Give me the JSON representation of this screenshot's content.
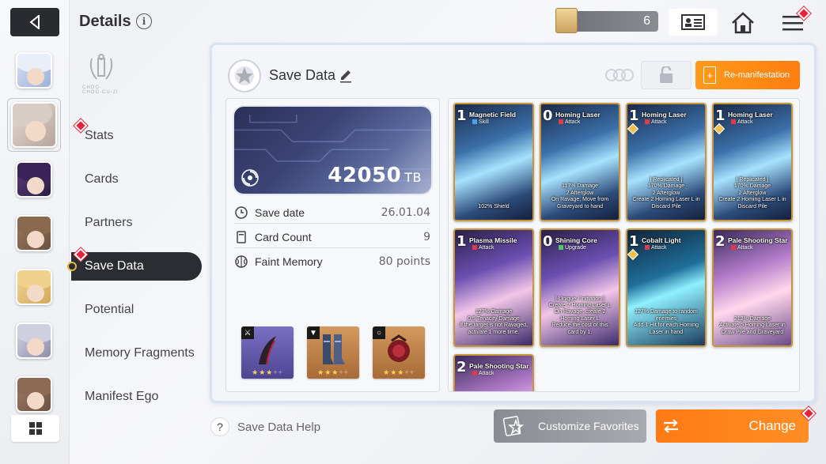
{
  "header": {
    "title": "Details",
    "info_icon": "i",
    "currency_value": "6",
    "icons": [
      "back-arrow-icon",
      "currency-ticket-icon",
      "profile-card-icon",
      "home-icon",
      "menu-icon"
    ]
  },
  "nav": {
    "items": [
      {
        "label": "Stats"
      },
      {
        "label": "Cards"
      },
      {
        "label": "Partners"
      },
      {
        "label": "Save Data",
        "active": true
      },
      {
        "label": "Potential"
      },
      {
        "label": "Memory Fragments"
      },
      {
        "label": "Manifest Ego"
      }
    ]
  },
  "panel": {
    "title": "Save Data",
    "remanifest_label": "Re-manifestation",
    "banner_value": "42050",
    "banner_unit": "TB",
    "stats": [
      {
        "label": "Save date",
        "value": "26.01.04",
        "icon": "clock-icon"
      },
      {
        "label": "Card Count",
        "value": "9",
        "icon": "card-icon"
      },
      {
        "label": "Faint Memory",
        "value": "80 points",
        "icon": "brain-icon"
      }
    ],
    "equipment": [
      {
        "tag": "⚔",
        "stars": 3,
        "max": 5,
        "icon": "weapon-horn-icon",
        "bg": "#6a5fb0"
      },
      {
        "tag": "👕",
        "stars": 3,
        "max": 5,
        "icon": "armor-boots-icon",
        "bg": "#c5874e"
      },
      {
        "tag": "○",
        "stars": 3,
        "max": 5,
        "icon": "ring-orb-icon",
        "bg": "#c5874e"
      }
    ]
  },
  "cards": [
    {
      "cost": "1",
      "name": "Magnetic Field",
      "type": "Skill",
      "type_kind": "skill",
      "desc": "102% Shield",
      "theme": "blue"
    },
    {
      "cost": "0",
      "name": "Homing Laser",
      "type": "Attack",
      "type_kind": "attack",
      "desc": "117% Damage\n2 Afterglow\nOn Ravage, Move from Graveyard to hand",
      "theme": "blue"
    },
    {
      "cost": "1",
      "name": "Homing Laser",
      "type": "Attack",
      "type_kind": "attack",
      "desc": "[ Replicated ]\n170% Damage\n2 Afterglow\nCreate 2 Homing Laser L in Discard Pile",
      "theme": "blue",
      "mark": true
    },
    {
      "cost": "1",
      "name": "Homing Laser",
      "type": "Attack",
      "type_kind": "attack",
      "desc": "[ Replicated ]\n170% Damage\n2 Afterglow\nCreate 2 Homing Laser L in Discard Pile",
      "theme": "blue",
      "mark": true
    },
    {
      "cost": "1",
      "name": "Plasma Missile",
      "type": "Attack",
      "type_kind": "attack",
      "desc": "127% Damage\n0.5 Tenacity Damage\nIf the target is not Ravaged, activate 1 more time.",
      "theme": "purple"
    },
    {
      "cost": "0",
      "name": "Shining Core",
      "type": "Upgrade",
      "type_kind": "upgrade",
      "desc": "[ Unique / Initiation ]\nCreate 2 Homing Laser L\nOn Ravage, create 2 Homing Laser L\nReduce the cost of this card by 1.",
      "theme": "purple"
    },
    {
      "cost": "1",
      "name": "Cobalt Light",
      "type": "Attack",
      "type_kind": "attack",
      "desc": "127% Damage to random enemies\nAdd 1 Hit for each Homing Laser in hand",
      "theme": "cyan",
      "mark": true
    },
    {
      "cost": "2",
      "name": "Pale Shooting Star",
      "type": "Attack",
      "type_kind": "attack",
      "desc": "212% Damage\nActivate 5 Homing Laser in Draw Pile and Graveyard",
      "theme": "pink"
    },
    {
      "cost": "2",
      "name": "Pale Shooting Star",
      "type": "Attack",
      "type_kind": "attack",
      "desc": "",
      "theme": "pink"
    }
  ],
  "bottom": {
    "help_icon": "?",
    "help_label": "Save Data Help",
    "customize_label": "Customize Favorites",
    "change_label": "Change"
  },
  "colors": {
    "accent_orange": "#ff8a1c",
    "dark": "#2c2d33",
    "alert_red": "#e8223a"
  }
}
